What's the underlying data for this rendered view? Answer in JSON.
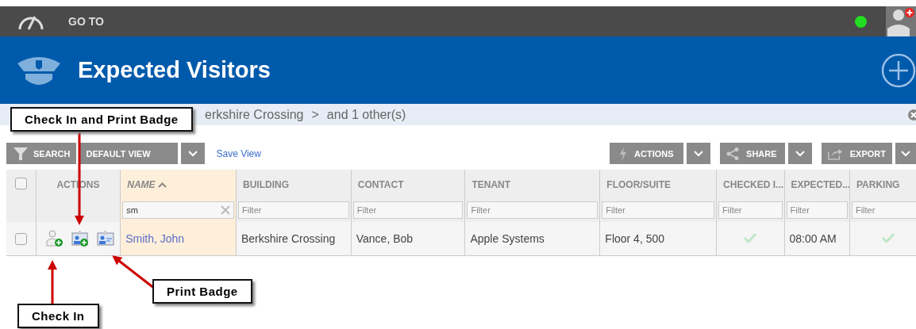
{
  "topbar": {
    "goto_label": "GO TO"
  },
  "header": {
    "title": "Expected Visitors"
  },
  "breadcrumb": {
    "items": [
      "erkshire Crossing",
      "and 1 other(s)"
    ],
    "separator": ">"
  },
  "toolbar": {
    "search_label": "SEARCH",
    "view_label": "DEFAULT VIEW",
    "save_view": "Save View",
    "actions_label": "ACTIONS",
    "share_label": "SHARE",
    "export_label": "EXPORT"
  },
  "table": {
    "columns": [
      {
        "kind": "select"
      },
      {
        "kind": "actions",
        "label": "ACTIONS"
      },
      {
        "kind": "link",
        "label": "NAME",
        "sorted": true,
        "filter": {
          "value": "sm"
        }
      },
      {
        "kind": "text",
        "label": "BUILDING",
        "filter": {
          "placeholder": "Filter"
        }
      },
      {
        "kind": "text",
        "label": "CONTACT",
        "filter": {
          "placeholder": "Filter"
        }
      },
      {
        "kind": "text",
        "label": "TENANT",
        "filter": {
          "placeholder": "Filter"
        }
      },
      {
        "kind": "text",
        "label": "FLOOR/SUITE",
        "filter": {
          "placeholder": "Filter"
        }
      },
      {
        "kind": "check",
        "label": "CHECKED I...",
        "filter": {
          "placeholder": "Filter"
        }
      },
      {
        "kind": "text",
        "label": "EXPECTED...",
        "filter": {
          "placeholder": "Filter"
        }
      },
      {
        "kind": "check",
        "label": "PARKING",
        "filter": {
          "placeholder": "Filter"
        }
      }
    ],
    "header_checked": false,
    "rows": [
      {
        "checked": false,
        "cells": [
          "",
          "",
          "Smith, John",
          "Berkshire Crossing",
          "Vance, Bob",
          "Apple Systems",
          "Floor 4, 500",
          true,
          "08:00 AM",
          true
        ]
      }
    ]
  },
  "callouts": [
    {
      "label": "Check In and Print Badge"
    },
    {
      "label": "Print Badge"
    },
    {
      "label": "Check In"
    }
  ]
}
